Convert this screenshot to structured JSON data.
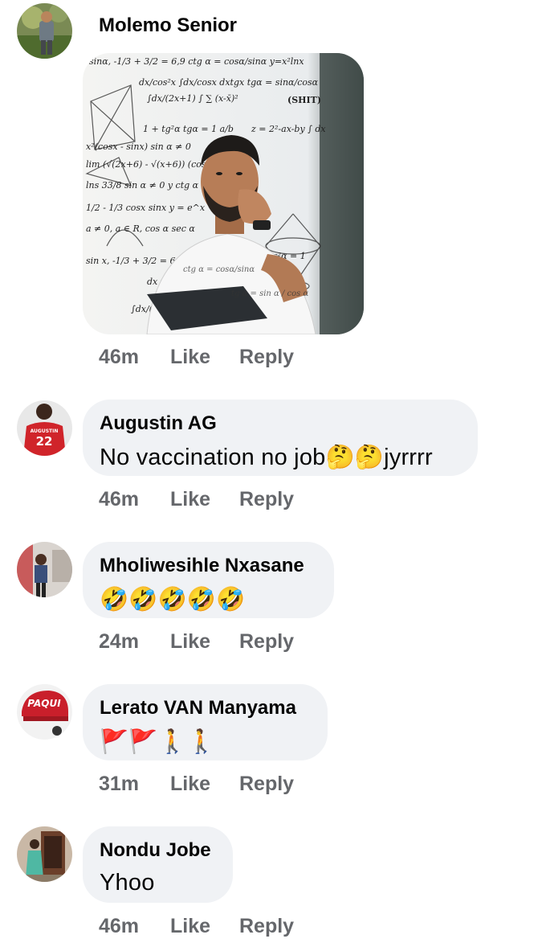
{
  "comments": [
    {
      "author": "Molemo Senior",
      "text": "",
      "photo": "photo of a thoughtful man surrounded by math formulas meme",
      "time": "46m",
      "like": "Like",
      "reply": "Reply"
    },
    {
      "author": "Augustin AG",
      "text": "No vaccination no job",
      "emoji_suffix": "🤔🤔",
      "text_tail": "jyrrrr",
      "time": "46m",
      "like": "Like",
      "reply": "Reply"
    },
    {
      "author": "Mholiwesihle Nxasane",
      "text": "🤣🤣🤣🤣🤣",
      "time": "24m",
      "like": "Like",
      "reply": "Reply"
    },
    {
      "author": "Lerato VAN Manyama",
      "text": "🚩🚩🚶🚶",
      "time": "31m",
      "like": "Like",
      "reply": "Reply"
    },
    {
      "author": "Nondu Jobe",
      "text": "Yhoo",
      "time": "46m",
      "like": "Like",
      "reply": "Reply"
    }
  ],
  "photo_labels": {
    "formula_1": "sin²α + cos²α = 1",
    "formula_2": "ctg α = cos α / sin α",
    "formula_3": "(SHIT)",
    "formula_4": "y = x² · ln x",
    "formula_5": "sin α ≠ 0",
    "formula_6": "tg α = sin α / cos α"
  },
  "avatar_labels": {
    "jersey_name": "AUGUSTIN",
    "jersey_number": "22",
    "cap_text": "PAQUI"
  }
}
